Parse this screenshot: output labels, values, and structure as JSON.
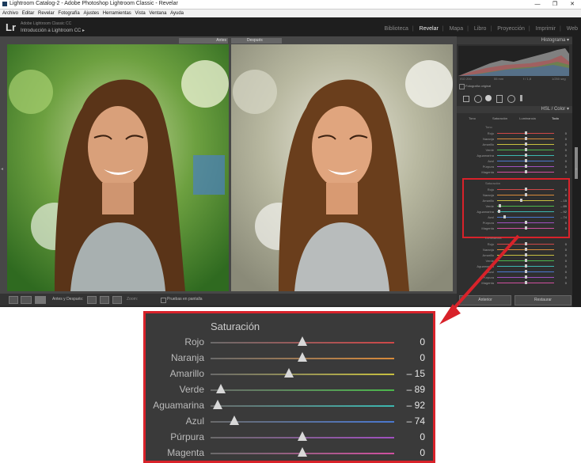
{
  "window": {
    "title": "Lightroom Catalog-2 - Adobe Photoshop Lightroom Classic - Revelar",
    "controls": [
      "—",
      "❐",
      "✕"
    ]
  },
  "menu": [
    "Archivo",
    "Editar",
    "Revelar",
    "Fotografía",
    "Ajustes",
    "Herramientas",
    "Vista",
    "Ventana",
    "Ayuda"
  ],
  "identity": {
    "logo": "Lr",
    "subtitle": "Adobe Lightroom Classic CC",
    "catalog": "Introducción a Lightroom CC ▸"
  },
  "modules": [
    "Biblioteca",
    "Revelar",
    "Mapa",
    "Libro",
    "Proyección",
    "Imprimir",
    "Web"
  ],
  "active_module": "Revelar",
  "view": {
    "before_label": "Antes",
    "after_label": "Después"
  },
  "toolbar": {
    "before_after": "Antes y Después:",
    "zoom": "Zoom:",
    "proof": "Pruebas en pantalla"
  },
  "panel": {
    "histogram": "Histograma",
    "histo_info": [
      "ISO 200",
      "55 mm",
      "f / 1,8",
      "1/250 seg"
    ],
    "original_photo": "Fotografía original",
    "hsl_header": "HSL / Color",
    "hsl_tabs": [
      "Tono",
      "Saturación",
      "Luminancia",
      "Todo"
    ],
    "group_tono": "Tono",
    "group_saturacion": "Saturación",
    "group_luminancia": "Luminancia",
    "colors": [
      "Rojo",
      "Naranja",
      "Amarillo",
      "Verde",
      "Aguamarina",
      "Azul",
      "Púrpura",
      "Magenta"
    ],
    "tono_values": [
      "0",
      "0",
      "0",
      "0",
      "0",
      "0",
      "0",
      "0"
    ],
    "sat_values": [
      "0",
      "0",
      "– 15",
      "– 89",
      "– 92",
      "– 74",
      "0",
      "0"
    ],
    "lum_values": [
      "0",
      "0",
      "0",
      "0",
      "0",
      "0",
      "0",
      "0"
    ],
    "btn_prev": "Anterior",
    "btn_reset": "Restaurar"
  },
  "zoom": {
    "title": "Saturación",
    "rows": [
      {
        "label": "Rojo",
        "value": "0",
        "level": 0,
        "color": "#d04848"
      },
      {
        "label": "Naranja",
        "value": "0",
        "level": 0,
        "color": "#d88a3a"
      },
      {
        "label": "Amarillo",
        "value": "– 15",
        "level": -15,
        "color": "#c8c040"
      },
      {
        "label": "Verde",
        "value": "– 89",
        "level": -89,
        "color": "#4cb84c"
      },
      {
        "label": "Aguamarina",
        "value": "– 92",
        "level": -92,
        "color": "#3cb8b0"
      },
      {
        "label": "Azul",
        "value": "– 74",
        "level": -74,
        "color": "#4a78d0"
      },
      {
        "label": "Púrpura",
        "value": "0",
        "level": 0,
        "color": "#a050c0"
      },
      {
        "label": "Magenta",
        "value": "0",
        "level": 0,
        "color": "#d050a0"
      }
    ]
  },
  "colors": {
    "highlight": "#d8222a",
    "ui_dark": "#2b2b2b"
  }
}
